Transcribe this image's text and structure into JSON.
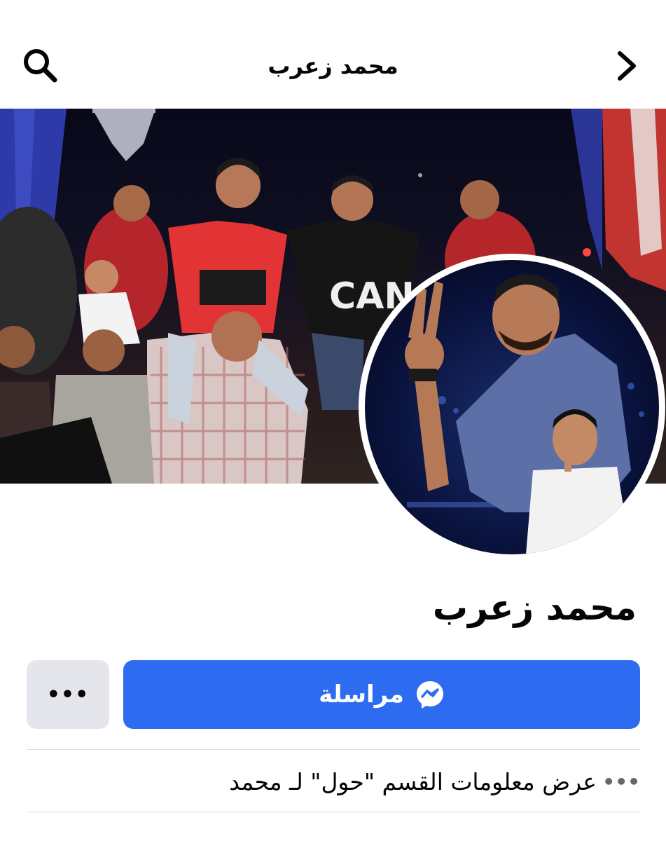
{
  "header": {
    "title": "محمد زعرب",
    "search_icon": "search-icon",
    "back_icon": "chevron-right-icon"
  },
  "profile": {
    "name": "محمد زعرب",
    "cover_photo": "group-celebration-photo",
    "avatar": "profile-picture"
  },
  "actions": {
    "message_label": "مراسلة",
    "message_icon": "messenger-icon",
    "more_label": "•••"
  },
  "about_row": {
    "text": "عرض معلومات القسم \"حول\" لـ محمد",
    "icon_label": "•••"
  },
  "colors": {
    "accent": "#2d6cf0",
    "secondary_button": "#e4e6eb",
    "text": "#050505",
    "muted": "#65676b"
  }
}
